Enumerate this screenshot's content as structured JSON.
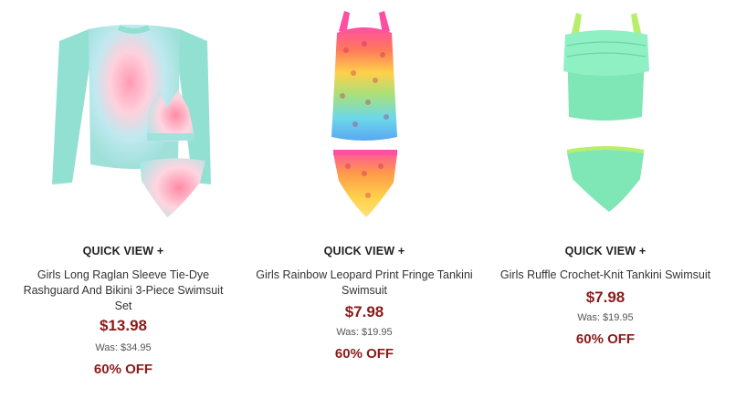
{
  "products": [
    {
      "quick_view": "QUICK VIEW +",
      "title": "Girls Long Raglan Sleeve Tie-Dye Rashguard And Bikini 3-Piece Swimsuit Set",
      "price": "$13.98",
      "was": "Was: $34.95",
      "discount": "60% OFF",
      "image_icon": "tie-dye-rashguard-set-image"
    },
    {
      "quick_view": "QUICK VIEW +",
      "title": "Girls Rainbow Leopard Print Fringe Tankini Swimsuit",
      "price": "$7.98",
      "was": "Was: $19.95",
      "discount": "60% OFF",
      "image_icon": "rainbow-leopard-tankini-image"
    },
    {
      "quick_view": "QUICK VIEW +",
      "title": "Girls Ruffle Crochet-Knit Tankini Swimsuit",
      "price": "$7.98",
      "was": "Was: $19.95",
      "discount": "60% OFF",
      "image_icon": "ruffle-crochet-tankini-image"
    }
  ],
  "colors": {
    "price": "#8b1a1a",
    "mint": "#8fe0cf",
    "green": "#7fe6b5"
  }
}
